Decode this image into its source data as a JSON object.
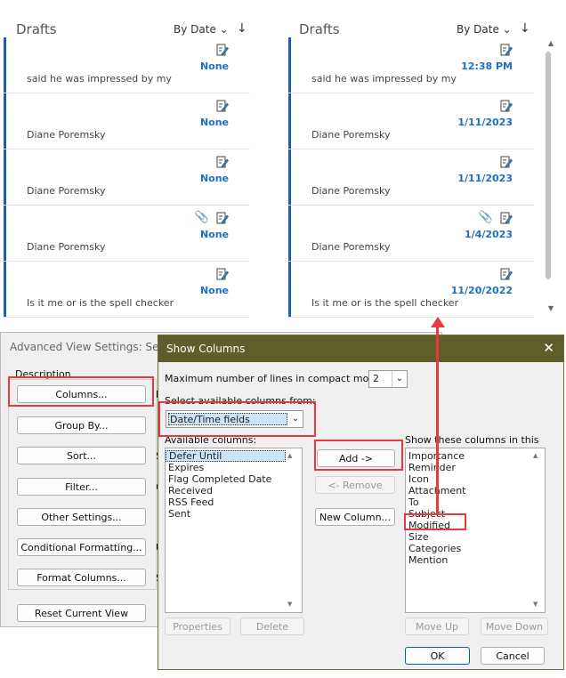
{
  "left_pane": {
    "title": "Drafts",
    "sort_label": "By Date",
    "sort_arrow": "↓",
    "items": [
      {
        "when": "None",
        "from": "said he was impressed by my",
        "attachment": false
      },
      {
        "when": "None",
        "from": "Diane Poremsky",
        "attachment": false
      },
      {
        "when": "None",
        "from": "Diane Poremsky",
        "attachment": false
      },
      {
        "when": "None",
        "from": "Diane Poremsky",
        "attachment": true
      },
      {
        "when": "None",
        "from": "Is it me or is the spell checker",
        "attachment": false
      }
    ]
  },
  "right_pane": {
    "title": "Drafts",
    "sort_label": "By Date",
    "sort_arrow": "↓",
    "items": [
      {
        "when": "12:38 PM",
        "from": "said he was impressed by my",
        "attachment": false
      },
      {
        "when": "1/11/2023",
        "from": "Diane Poremsky",
        "attachment": false
      },
      {
        "when": "1/11/2023",
        "from": "Diane Poremsky",
        "attachment": false
      },
      {
        "when": "1/4/2023",
        "from": "Diane Poremsky",
        "attachment": true
      },
      {
        "when": "11/20/2022",
        "from": "Is it me or is the spell checker",
        "attachment": false
      }
    ]
  },
  "advanced_view": {
    "title": "Advanced View Settings: Sent T",
    "description_label": "Description",
    "buttons": [
      "Columns...",
      "Group By...",
      "Sort...",
      "Filter...",
      "Other Settings...",
      "Conditional Formatting...",
      "Format Columns..."
    ],
    "side_letters": [
      "I",
      "",
      "S",
      "O",
      "",
      "U",
      "S"
    ],
    "reset_label": "Reset Current View"
  },
  "show_columns": {
    "title": "Show Columns",
    "close_glyph": "✕",
    "max_lines_label": "Maximum number of lines in compact mode:",
    "max_lines_value": "2",
    "select_from_label": "Select available columns from:",
    "select_from_value": "Date/Time fields",
    "available_label": "Available columns:",
    "available": [
      "Defer Until",
      "Expires",
      "Flag Completed Date",
      "Received",
      "RSS Feed",
      "Sent"
    ],
    "show_label": "Show these columns in this order:",
    "shown": [
      "Importance",
      "Reminder",
      "Icon",
      "Attachment",
      "To",
      "Subject",
      "Modified",
      "Size",
      "Categories",
      "Mention"
    ],
    "add_label": "Add ->",
    "remove_label": "<- Remove",
    "new_column_label": "New Column...",
    "properties_label": "Properties",
    "delete_label": "Delete",
    "move_up_label": "Move Up",
    "move_down_label": "Move Down",
    "ok_label": "OK",
    "cancel_label": "Cancel"
  },
  "colors": {
    "highlight": "#e8393e",
    "accent": "#1f6fc1",
    "titlebar": "#5e5e2b"
  }
}
